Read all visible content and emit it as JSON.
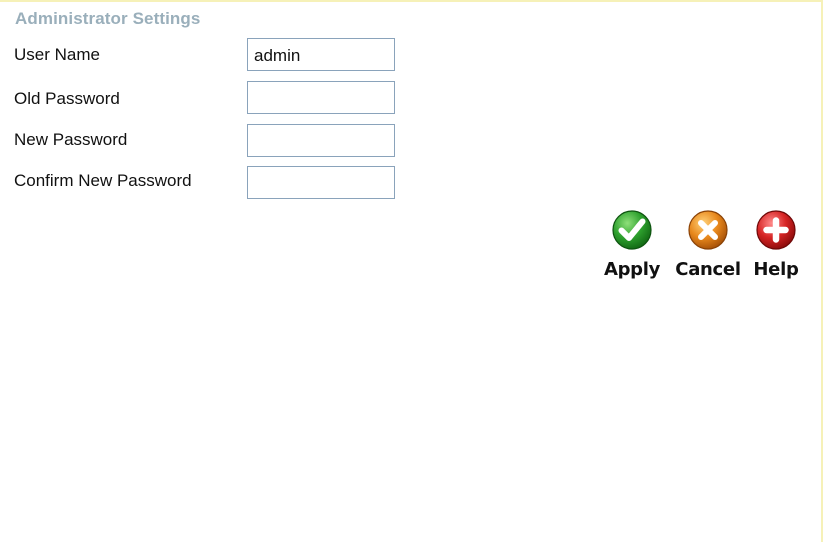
{
  "section": {
    "title": "Administrator Settings"
  },
  "form": {
    "user_name": {
      "label": "User Name",
      "value": "admin"
    },
    "old_password": {
      "label": "Old Password",
      "value": ""
    },
    "new_password": {
      "label": "New Password",
      "value": ""
    },
    "confirm_password": {
      "label": "Confirm New Password",
      "value": ""
    }
  },
  "actions": {
    "apply": {
      "label": "Apply",
      "icon": "check-icon",
      "color": "#2ea12e"
    },
    "cancel": {
      "label": "Cancel",
      "icon": "x-icon",
      "color": "#e8881c"
    },
    "help": {
      "label": "Help",
      "icon": "plus-icon",
      "color": "#d62424"
    }
  },
  "colors": {
    "title": "#9aafbb",
    "input_border": "#8aa3bb",
    "frame_border": "#f6f1b8"
  }
}
